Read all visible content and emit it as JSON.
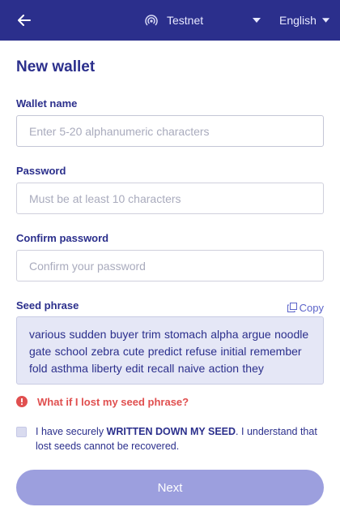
{
  "header": {
    "network_label": "Testnet",
    "language_label": "English",
    "bg_color": "#2b2f8c"
  },
  "form": {
    "title": "New wallet",
    "wallet_name": {
      "label": "Wallet name",
      "placeholder": "Enter 5-20 alphanumeric characters",
      "value": ""
    },
    "password": {
      "label": "Password",
      "placeholder": "Must be at least 10 characters",
      "value": ""
    },
    "confirm_password": {
      "label": "Confirm password",
      "placeholder": "Confirm your password",
      "value": ""
    },
    "seed": {
      "label": "Seed phrase",
      "copy_label": "Copy",
      "phrase": "various sudden buyer trim stomach alpha argue noodle gate school zebra cute predict refuse initial remember fold asthma liberty edit recall naive action they"
    },
    "warning_label": "What if I lost my seed phrase?",
    "ack": {
      "prefix": "I have securely ",
      "emphasis": "WRITTEN DOWN MY SEED",
      "suffix": ". I understand that lost seeds cannot be recovered.",
      "checked": false
    },
    "next_label": "Next"
  },
  "colors": {
    "accent": "#2b2f8c",
    "button_disabled": "#9c9fde",
    "warning": "#e04f4f",
    "seed_bg": "#e5e7f6"
  },
  "icons": {
    "back": "arrow-left-icon",
    "network": "broadcast-icon",
    "dropdown": "chevron-down-icon",
    "copy": "copy-icon",
    "warning": "alert-circle-icon"
  }
}
